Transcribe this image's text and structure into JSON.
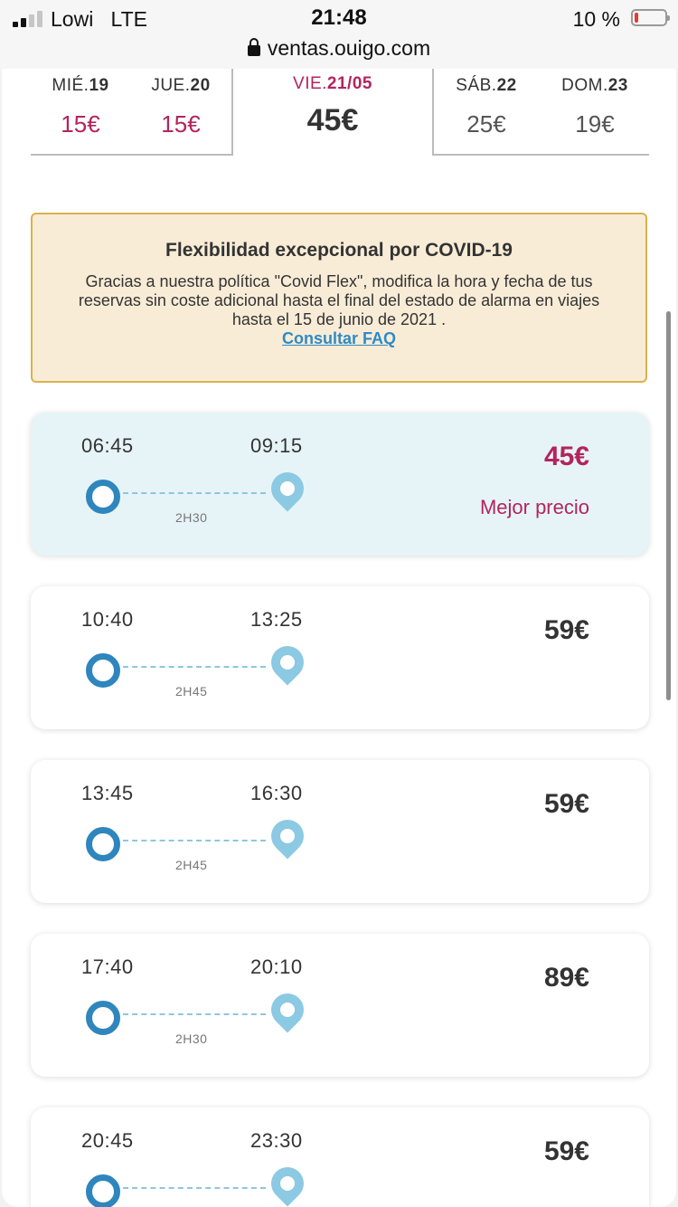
{
  "status_bar": {
    "carrier": "Lowi",
    "network": "LTE",
    "time": "21:48",
    "battery": "10 %",
    "url": "ventas.ouigo.com"
  },
  "dates": [
    {
      "weekday": "MIÉ.",
      "day": "19",
      "price": "15€"
    },
    {
      "weekday": "JUE.",
      "day": "20",
      "price": "15€"
    },
    {
      "weekday": "VIE.",
      "day": "21/05",
      "price": "45€"
    },
    {
      "weekday": "SÁB.",
      "day": "22",
      "price": "25€"
    },
    {
      "weekday": "DOM.",
      "day": "23",
      "price": "19€"
    }
  ],
  "covid": {
    "title": "Flexibilidad excepcional por COVID-19",
    "text": "Gracias a nuestra política \"Covid Flex\", modifica la hora y fecha de tus reservas sin coste adicional hasta el final del estado de alarma en viajes hasta el 15 de junio de 2021 .",
    "link": "Consultar FAQ"
  },
  "trips": [
    {
      "departure": "06:45",
      "arrival": "09:15",
      "duration": "2H30",
      "price": "45€",
      "label": "Mejor precio"
    },
    {
      "departure": "10:40",
      "arrival": "13:25",
      "duration": "2H45",
      "price": "59€"
    },
    {
      "departure": "13:45",
      "arrival": "16:30",
      "duration": "2H45",
      "price": "59€"
    },
    {
      "departure": "17:40",
      "arrival": "20:10",
      "duration": "2H30",
      "price": "89€"
    },
    {
      "departure": "20:45",
      "arrival": "23:30",
      "duration": "",
      "price": "59€"
    }
  ],
  "colors": {
    "accent_pink": "#b3245e",
    "origin_blue": "#2e86bd",
    "pin_blue": "#8cc9e3",
    "best_bg": "#e6f4f8",
    "notice_bg": "#f9ecd7",
    "notice_border": "#d9b24f",
    "link": "#2e8bc4"
  }
}
